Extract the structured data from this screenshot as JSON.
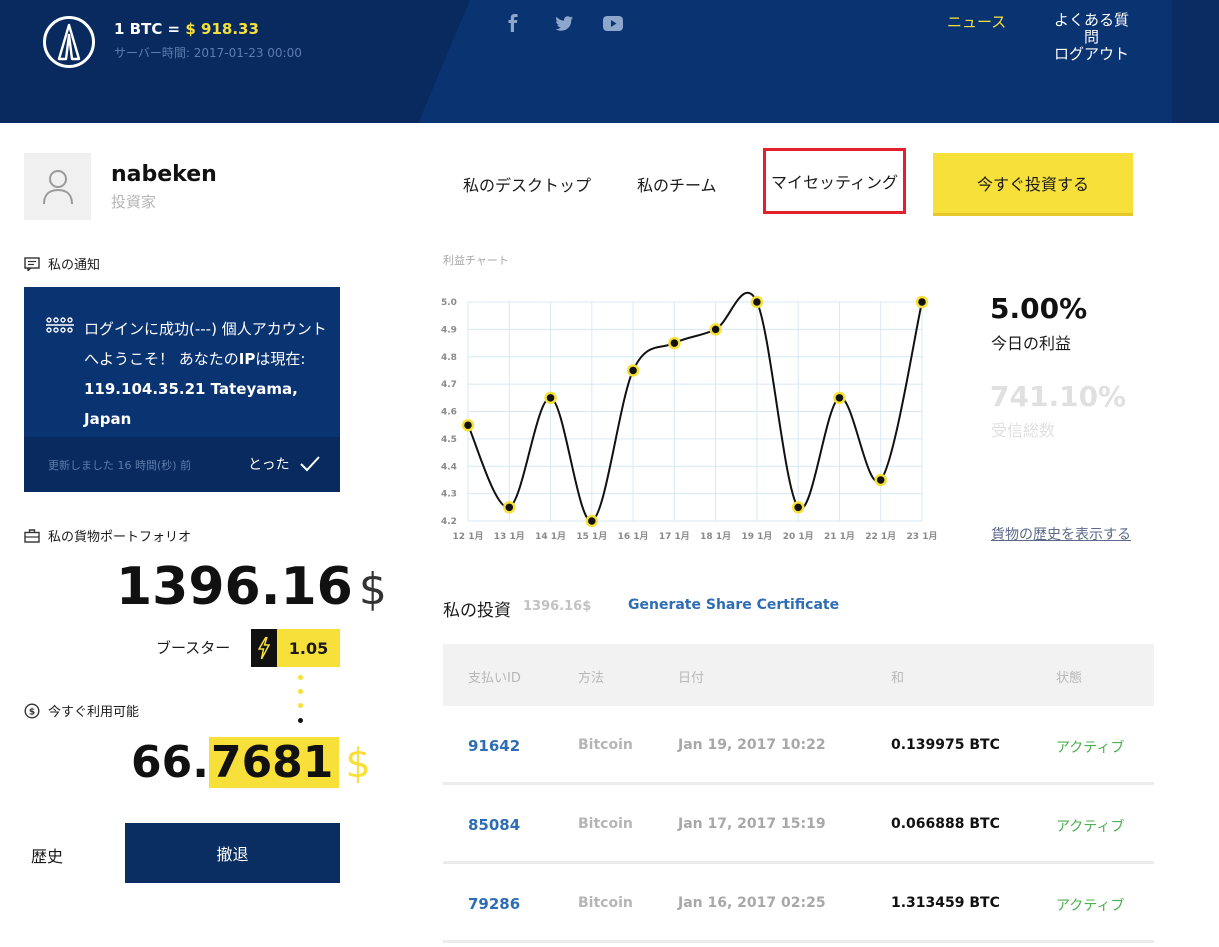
{
  "header": {
    "btc_label": "1 BTC =",
    "btc_price": "$ 918.33",
    "server_time": "サーバー時間: 2017-01-23 00:00",
    "nav": {
      "news": "ニュース",
      "faq": "よくある質問",
      "logout": "ログアウト"
    },
    "social_icons": [
      "facebook-icon",
      "twitter-icon",
      "youtube-icon"
    ]
  },
  "profile": {
    "username": "nabeken",
    "role": "投資家"
  },
  "notifications": {
    "title": "私の通知",
    "message_intro": "ログインに成功(---) 個人アカウントへようこそ！ あなたの",
    "message_ip_label": "IP",
    "message_mid": "は現在: ",
    "message_ip": "119.104.35.21 Tateyama, Japan",
    "updated": "更新しました 16 時間(秒) 前",
    "dismiss": "とった"
  },
  "portfolio": {
    "title": "私の貨物ポートフォリオ",
    "value": "1396.16",
    "currency": "$",
    "booster_label": "ブースター",
    "booster_value": "1.05",
    "available_title": "今すぐ利用可能",
    "available_int": "66.",
    "available_dec": "7681",
    "available_currency": "$"
  },
  "actions": {
    "history": "歴史",
    "withdraw": "撤退"
  },
  "tabs": {
    "desktop": "私のデスクトップ",
    "team": "私のチーム",
    "settings": "マイセッティング",
    "invest_now": "今すぐ投資する"
  },
  "stats": {
    "today_profit": "5.00%",
    "today_profit_label": "今日の利益",
    "total_received": "741.10%",
    "total_received_label": "受信総数",
    "history_link": "貨物の歴史を表示する"
  },
  "chart_data": {
    "type": "line",
    "title": "利益チャート",
    "categories": [
      "12 1月",
      "13 1月",
      "14 1月",
      "15 1月",
      "16 1月",
      "17 1月",
      "18 1月",
      "19 1月",
      "20 1月",
      "21 1月",
      "22 1月",
      "23 1月"
    ],
    "values": [
      4.55,
      4.25,
      4.65,
      4.2,
      4.75,
      4.85,
      4.9,
      5.0,
      4.25,
      4.65,
      4.35,
      5.0
    ],
    "yticks": [
      "5.0",
      "4.9",
      "4.8",
      "4.7",
      "4.6",
      "4.5",
      "4.4",
      "4.3",
      "4.2"
    ],
    "ylim": [
      4.2,
      5.0
    ],
    "grid": true,
    "line_color": "#111111",
    "marker_color": "#f7e03a",
    "grid_color": "#d6e8f5"
  },
  "investments": {
    "title": "私の投資",
    "total": "1396.16$",
    "share_link": "Generate Share Certificate",
    "columns": [
      "支払いID",
      "方法",
      "日付",
      "和",
      "状態"
    ],
    "rows": [
      {
        "id": "91642",
        "method": "Bitcoin",
        "date": "Jan 19, 2017 10:22",
        "amount": "0.139975 BTC",
        "status": "アクティブ"
      },
      {
        "id": "85084",
        "method": "Bitcoin",
        "date": "Jan 17, 2017 15:19",
        "amount": "0.066888 BTC",
        "status": "アクティブ"
      },
      {
        "id": "79286",
        "method": "Bitcoin",
        "date": "Jan 16, 2017 02:25",
        "amount": "1.313459 BTC",
        "status": "アクティブ"
      }
    ]
  },
  "colors": {
    "navy": "#0a3372",
    "yellow": "#f7e03a",
    "active_tab_border": "#e3202b",
    "link_blue": "#2f6db5",
    "status_green": "#4caf50"
  }
}
